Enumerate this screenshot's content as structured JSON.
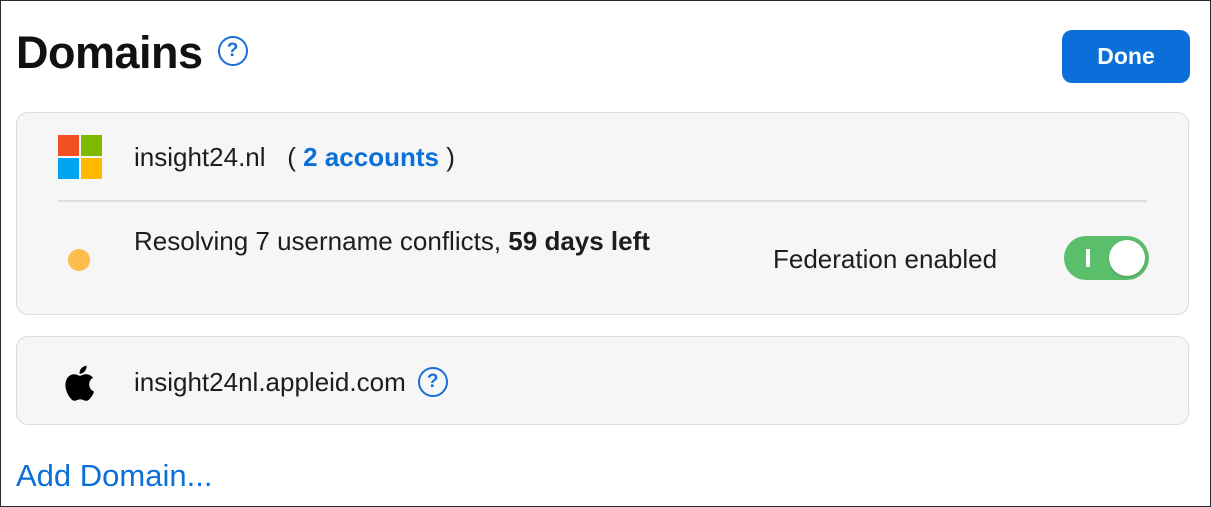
{
  "header": {
    "title": "Domains",
    "help_glyph": "?",
    "done_label": "Done"
  },
  "domains": [
    {
      "name": "insight24.nl",
      "provider_icon": "microsoft-logo-icon",
      "paren_open": "(",
      "accounts_link": "2 accounts",
      "paren_close": ")",
      "status_prefix": "Resolving 7 username conflicts,",
      "status_emphasis": "59 days left",
      "status_color": "#fbbd4b",
      "federation_label": "Federation enabled",
      "federation_enabled": true
    },
    {
      "name": "insight24nl.appleid.com",
      "provider_icon": "apple-logo-icon",
      "help_glyph": "?"
    }
  ],
  "footer": {
    "add_domain_label": "Add Domain..."
  },
  "colors": {
    "accent": "#0a6fd8",
    "toggle_on": "#5bbe6a",
    "card_bg": "#f6f6f6",
    "card_border": "#dcdcdc"
  }
}
